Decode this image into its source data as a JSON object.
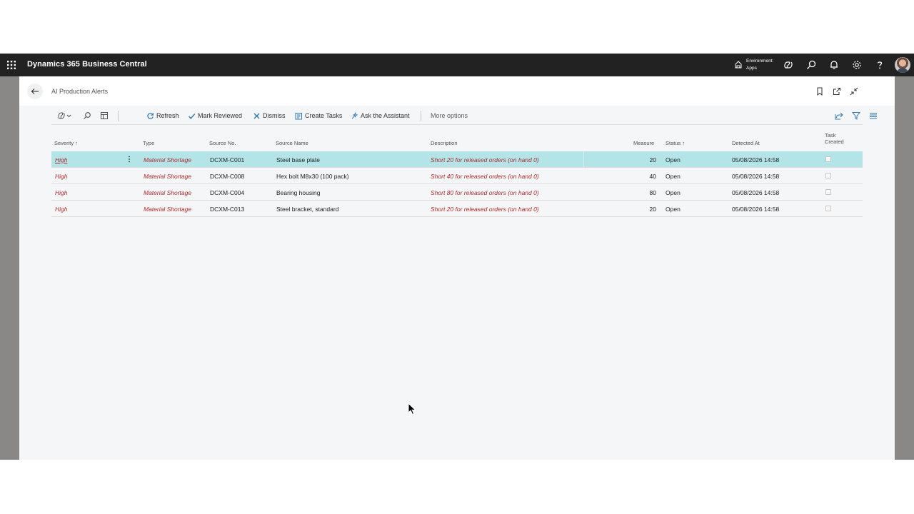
{
  "topbar": {
    "app_title": "Dynamics 365 Business Central",
    "environment_line1": "Environment:",
    "environment_line2": "Apps"
  },
  "page": {
    "title": "AI Production Alerts"
  },
  "actions": {
    "refresh": "Refresh",
    "mark_reviewed": "Mark Reviewed",
    "dismiss": "Dismiss",
    "create_tasks": "Create Tasks",
    "ask_assistant": "Ask the Assistant",
    "more_options": "More options"
  },
  "table": {
    "headers": {
      "severity": "Severity ↑",
      "type": "Type",
      "source_no": "Source No.",
      "source_name": "Source Name",
      "description": "Description",
      "measure": "Measure",
      "status": "Status ↑",
      "detected_at": "Detected At",
      "task_created_1": "Task",
      "task_created_2": "Created"
    },
    "rows": [
      {
        "severity": "High",
        "type": "Material Shortage",
        "source_no": "DCXM-C001",
        "source_name": "Steel base plate",
        "description": "Short 20 for released orders (on hand 0)",
        "measure": "20",
        "status": "Open",
        "detected_at": "05/08/2026 14:58",
        "task_created": false,
        "selected": true
      },
      {
        "severity": "High",
        "type": "Material Shortage",
        "source_no": "DCXM-C008",
        "source_name": "Hex bolt M8x30 (100 pack)",
        "description": "Short 40 for released orders (on hand 0)",
        "measure": "40",
        "status": "Open",
        "detected_at": "05/08/2026 14:58",
        "task_created": false,
        "selected": false
      },
      {
        "severity": "High",
        "type": "Material Shortage",
        "source_no": "DCXM-C004",
        "source_name": "Bearing housing",
        "description": "Short 80 for released orders (on hand 0)",
        "measure": "80",
        "status": "Open",
        "detected_at": "05/08/2026 14:58",
        "task_created": false,
        "selected": false
      },
      {
        "severity": "High",
        "type": "Material Shortage",
        "source_no": "DCXM-C013",
        "source_name": "Steel bracket, standard",
        "description": "Short 20 for released orders (on hand 0)",
        "measure": "20",
        "status": "Open",
        "detected_at": "05/08/2026 14:58",
        "task_created": false,
        "selected": false
      }
    ]
  },
  "colors": {
    "topbar": "#222222",
    "selected_row": "#b3e5e8",
    "alert_text": "#b22a2a"
  }
}
